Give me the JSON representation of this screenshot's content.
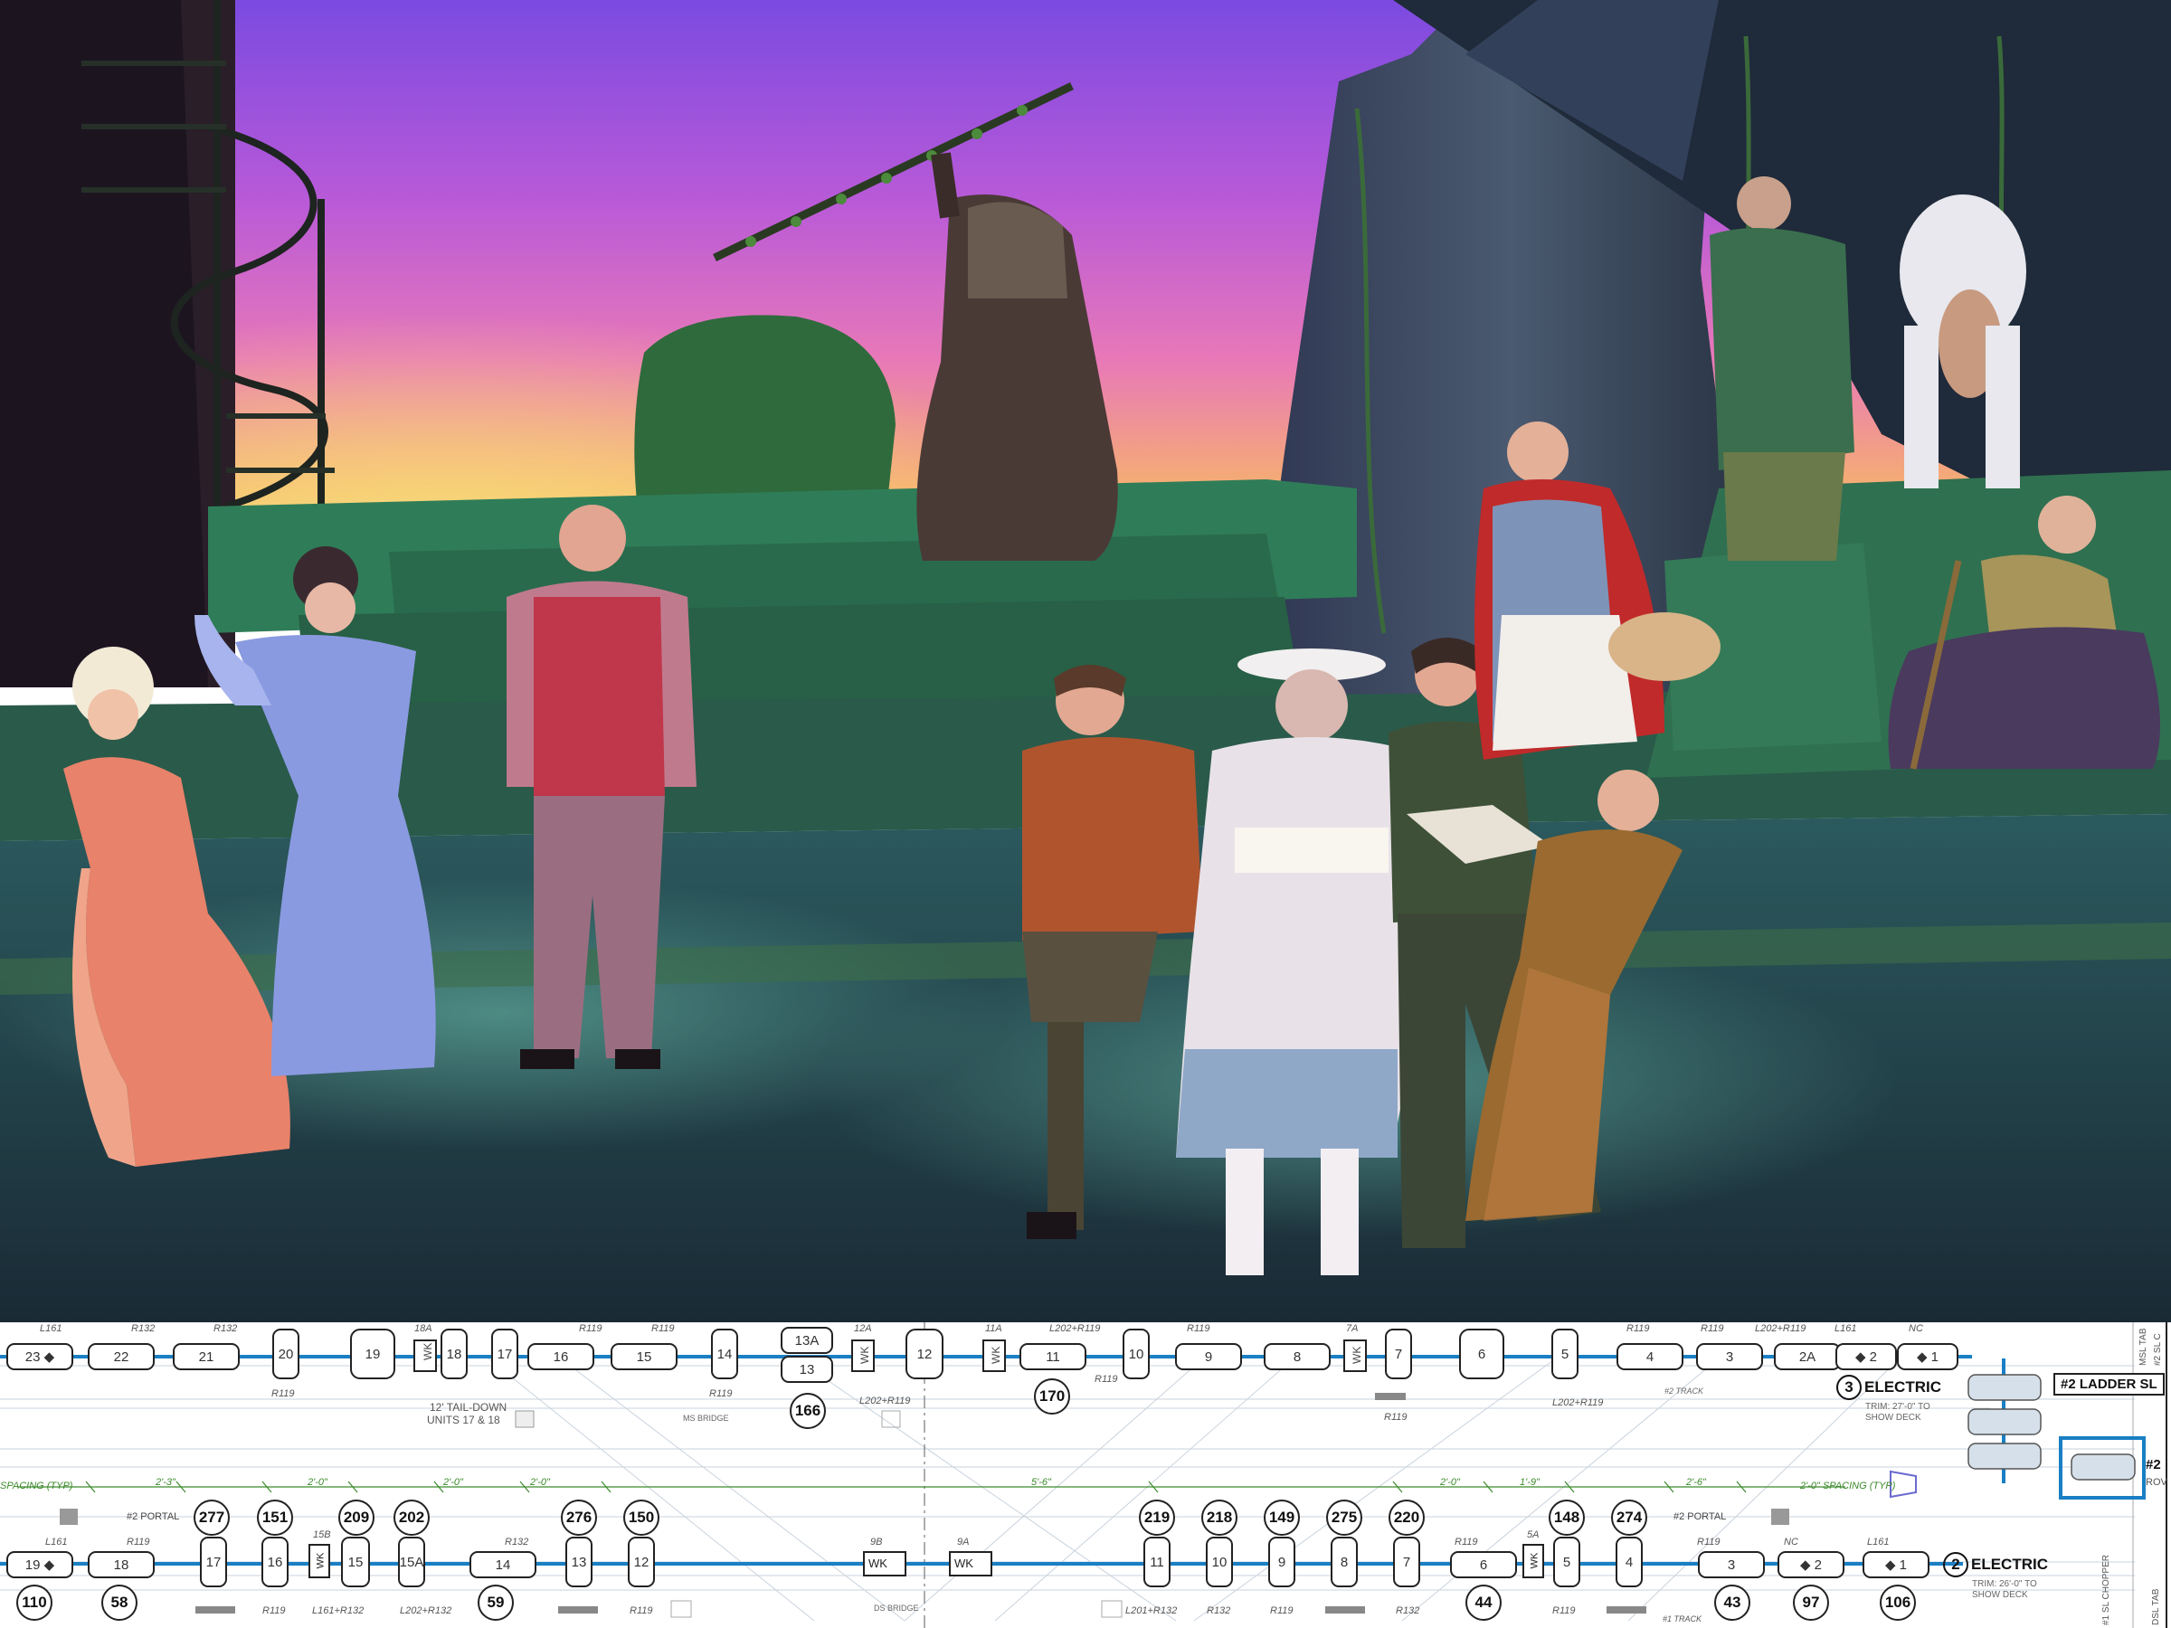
{
  "photo": {
    "description_icon": "theatre-stage-photo",
    "colors": {
      "sky_top": "#6a3fd8",
      "sky_mid": "#c85bd0",
      "sky_low": "#f0a060",
      "stage_green": "#2e7d5a",
      "floor": "#2a4a52"
    }
  },
  "plot": {
    "colors": {
      "pipe": "#1a7fc4",
      "line": "#222222",
      "green": "#3a8a2a"
    },
    "top_row": {
      "fixtures": [
        "23",
        "22",
        "21",
        "20",
        "19",
        "18",
        "17",
        "16",
        "15",
        "14",
        "13A",
        "13",
        "12",
        "11",
        "10",
        "9",
        "8",
        "7",
        "6",
        "5",
        "4",
        "3",
        "2A",
        "2",
        "1"
      ],
      "wk_labels": [
        "WK",
        "WK",
        "WK",
        "WK"
      ],
      "fixture_markers": {
        "first": "23 ◆",
        "last_a": "◆ 2",
        "last_b": "◆ 1"
      },
      "gel_labels": [
        "L161",
        "R132",
        "R132",
        "R119",
        "R119",
        "R119",
        "R119",
        "L202+R119",
        "R119",
        "R119",
        "R119",
        "L202+R119",
        "L161",
        "NC",
        "R119",
        "R119",
        "R119",
        "R119",
        "L202+R119",
        "R119"
      ],
      "circuits": [
        "166",
        "170"
      ],
      "notes": [
        "12' TAIL-DOWN",
        "UNITS 17 & 18",
        "MS BRIDGE",
        "#2 TRACK"
      ],
      "unit_labels": [
        "18A",
        "12A",
        "11A",
        "7A"
      ],
      "electric": {
        "number": "3",
        "label": "ELECTRIC",
        "trim": "TRIM: 27'-0\" TO",
        "trim2": "SHOW DECK"
      },
      "ladder": "#2 LADDER SL",
      "ladder_r": "#2",
      "row_label": "ROV"
    },
    "middle": {
      "spacing_left": "SPACING (TYP)",
      "spacing_right": "2'-0\" SPACING (TYP)",
      "dims": [
        "2'-3\"",
        "2'-0\"",
        "2'-0\"",
        "2'-0\"",
        "5'-6\"",
        "2'-0\"",
        "1'-9\"",
        "2'-6\""
      ],
      "portal_left": "#2 PORTAL",
      "portal_right": "#2 PORTAL"
    },
    "bottom_row": {
      "circuits_top": [
        "277",
        "151",
        "209",
        "202",
        "276",
        "150",
        "219",
        "218",
        "149",
        "275",
        "220",
        "148",
        "274"
      ],
      "fixtures": [
        "19",
        "18",
        "17",
        "16",
        "15",
        "15A",
        "14",
        "13",
        "12",
        "9B",
        "9A",
        "11",
        "10",
        "9",
        "8",
        "7",
        "6",
        "5",
        "4",
        "3",
        "2",
        "1"
      ],
      "fixture_markers": {
        "first": "19 ◆",
        "two": "◆ 2",
        "one": "◆ 1"
      },
      "wk_labels": [
        "WK",
        "WK",
        "WK",
        "WK"
      ],
      "unit_labels": [
        "15B",
        "5A"
      ],
      "gel_top": [
        "L161",
        "R119",
        "R132",
        "R119",
        "R119",
        "NC",
        "L161"
      ],
      "gel_bottom": [
        "R119",
        "L161+R132",
        "L202+R132",
        "R119",
        "L201+R132",
        "R132",
        "R119",
        "R132",
        "R119",
        "#1 TRACK"
      ],
      "circuits_bottom": [
        "110",
        "58",
        "59",
        "44",
        "43",
        "97",
        "106"
      ],
      "notes": [
        "DS BRIDGE"
      ],
      "electric": {
        "number": "2",
        "label": "ELECTRIC",
        "trim": "TRIM: 26'-0\" TO",
        "trim2": "SHOW DECK"
      },
      "side_labels": [
        "#1 SL CHOPPER",
        "DSL TAB",
        "MSL TAB",
        "#2 SL C"
      ]
    }
  }
}
